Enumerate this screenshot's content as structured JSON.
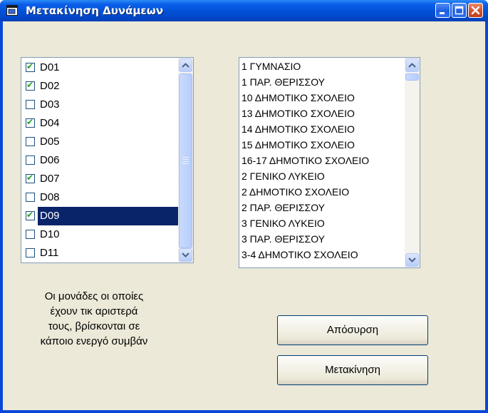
{
  "window": {
    "title": "Μετακίνηση Δυνάμεων"
  },
  "units_list": {
    "items": [
      {
        "label": "D01",
        "checked": true
      },
      {
        "label": "D02",
        "checked": true
      },
      {
        "label": "D03",
        "checked": false
      },
      {
        "label": "D04",
        "checked": true
      },
      {
        "label": "D05",
        "checked": false
      },
      {
        "label": "D06",
        "checked": false
      },
      {
        "label": "D07",
        "checked": true
      },
      {
        "label": "D08",
        "checked": false
      },
      {
        "label": "D09",
        "checked": true,
        "selected": true
      },
      {
        "label": "D10",
        "checked": false
      },
      {
        "label": "D11",
        "checked": false
      }
    ]
  },
  "locations_list": {
    "items": [
      "1 ΓΥΜΝΑΣΙΟ",
      "1 ΠΑΡ. ΘΕΡΙΣΣΟΥ",
      "10 ΔΗΜΟΤΙΚΟ ΣΧΟΛΕΙΟ",
      "13 ΔΗΜΟΤΙΚΟ ΣΧΟΛΕΙΟ",
      "14 ΔΗΜΟΤΙΚΟ ΣΧΟΛΕΙΟ",
      "15 ΔΗΜΟΤΙΚΟ ΣΧΟΛΕΙΟ",
      "16-17 ΔΗΜΟΤΙΚΟ ΣΧΟΛΕΙΟ",
      "2 ΓΕΝΙΚΟ ΛΥΚΕΙΟ",
      "2 ΔΗΜΟΤΙΚΟ ΣΧΟΛΕΙΟ",
      "2 ΠΑΡ. ΘΕΡΙΣΣΟΥ",
      "3 ΓΕΝΙΚΟ ΛΥΚΕΙΟ",
      "3 ΠΑΡ. ΘΕΡΙΣΣΟΥ",
      "3-4 ΔΗΜΟΤΙΚΟ ΣΧΟΛΕΙΟ"
    ]
  },
  "note": {
    "line1": "Οι μονάδες οι οποίες",
    "line2": "έχουν τικ αριστερά",
    "line3": "τους, βρίσκονται σε",
    "line4": "κάποιο ενεργό συμβάν"
  },
  "buttons": {
    "withdraw": "Απόσυρση",
    "move": "Μετακίνηση"
  },
  "icons": {
    "window": "app-window-icon",
    "minimize": "minimize-icon",
    "maximize": "maximize-icon",
    "close": "close-icon",
    "scroll_up": "scroll-up-arrow-icon",
    "scroll_down": "scroll-down-arrow-icon",
    "checkbox": "checkbox-icon"
  },
  "colors": {
    "titlebar": "#0054e3",
    "selection": "#0a246a",
    "dialog_bg": "#ece9d8",
    "check": "#21a121",
    "close_button": "#d6542e"
  }
}
